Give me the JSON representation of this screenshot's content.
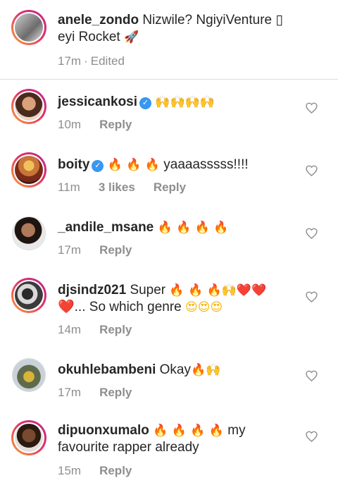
{
  "caption": {
    "username": "anele_zondo",
    "text": "Nizwile? NgiyiVenture ▯ eyi Rocket",
    "rocket_emoji": "🚀",
    "time": "17m",
    "edited": "Edited"
  },
  "icons": {
    "verified": "verified-badge-icon",
    "like": "heart-outline-icon"
  },
  "colors": {
    "verified": "#3897f0",
    "meta": "#8e8e8e",
    "divider": "#dbdbdb"
  },
  "comments": [
    {
      "username": "jessicankosi",
      "verified": true,
      "text": "",
      "emoji": "🙌🙌🙌🙌",
      "time": "10m",
      "likes": "",
      "reply": "Reply"
    },
    {
      "username": "boity",
      "verified": true,
      "text": "yaaaasssss!!!!",
      "emoji": "🔥 🔥 🔥",
      "time": "11m",
      "likes": "3 likes",
      "reply": "Reply"
    },
    {
      "username": "_andile_msane",
      "verified": false,
      "text": "",
      "emoji": "🔥 🔥 🔥 🔥",
      "time": "17m",
      "likes": "",
      "reply": "Reply"
    },
    {
      "username": "djsindz021",
      "verified": false,
      "text": "Super",
      "emoji": "🔥 🔥 🔥🙌❤️❤️",
      "text2": "❤️... So which genre",
      "emoji2": "😍😍😍",
      "time": "14m",
      "likes": "",
      "reply": "Reply"
    },
    {
      "username": "okuhlebambeni",
      "verified": false,
      "text": "Okay",
      "emoji": "🔥🙌",
      "time": "17m",
      "likes": "",
      "reply": "Reply"
    },
    {
      "username": "dipuonxumalo",
      "verified": false,
      "text": "my",
      "emoji": "🔥 🔥 🔥 🔥",
      "text2": "favourite rapper already",
      "time": "15m",
      "likes": "",
      "reply": "Reply"
    }
  ]
}
